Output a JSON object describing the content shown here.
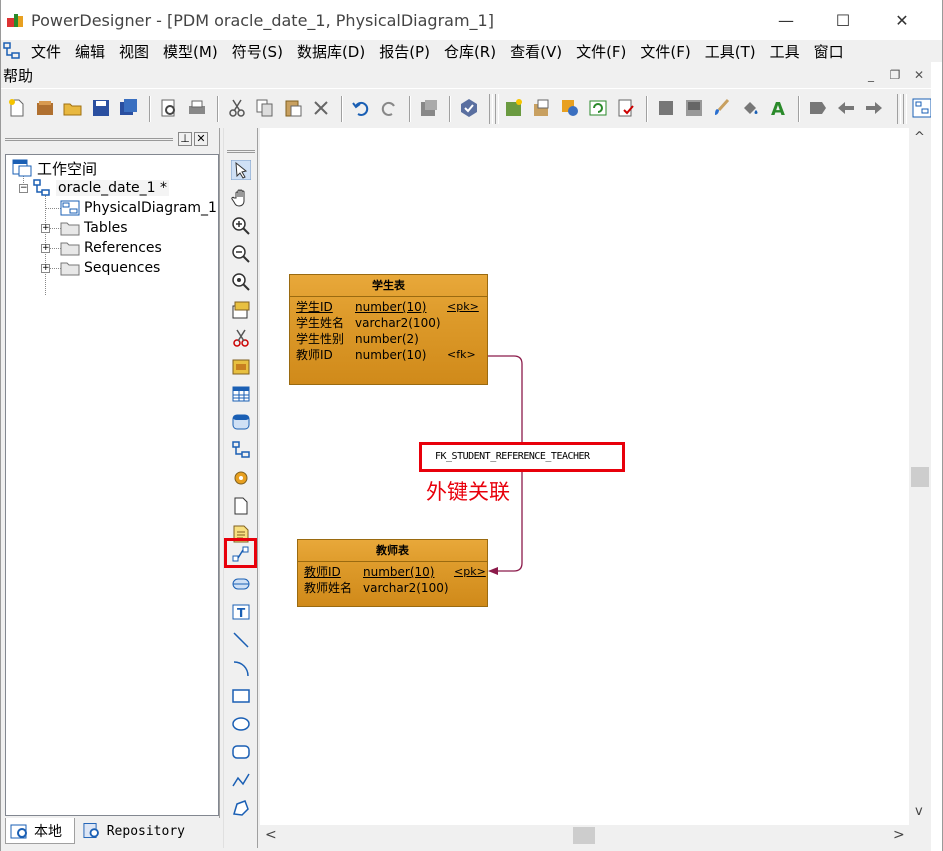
{
  "window": {
    "title": "PowerDesigner - [PDM oracle_date_1, PhysicalDiagram_1]",
    "minimize": "—",
    "maximize": "☐",
    "close": "✕"
  },
  "menu": {
    "items": [
      "文件",
      "编辑",
      "视图",
      "模型(M)",
      "符号(S)",
      "数据库(D)",
      "报告(P)",
      "仓库(R)",
      "查看(V)",
      "文件(F)",
      "文件(F)",
      "工具(T)",
      "工具",
      "窗口"
    ],
    "row2": "帮助",
    "mdi_minimize": "_",
    "mdi_restore": "❐",
    "mdi_close": "✕"
  },
  "browser": {
    "pin_button": "⊥",
    "close_button": "✕",
    "tree": {
      "workspace": "工作空间",
      "model": "oracle_date_1 *",
      "diagram": "PhysicalDiagram_1",
      "tables": "Tables",
      "references": "References",
      "sequences": "Sequences"
    },
    "tabs": {
      "local": "本地",
      "repository": "Repository"
    }
  },
  "diagram": {
    "student_table": {
      "name": "学生表",
      "columns": [
        {
          "name": "学生ID",
          "type": "number(10)",
          "key": "<pk>"
        },
        {
          "name": "学生姓名",
          "type": "varchar2(100)",
          "key": ""
        },
        {
          "name": "学生性别",
          "type": "number(2)",
          "key": ""
        },
        {
          "name": "教师ID",
          "type": "number(10)",
          "key": "<fk>"
        }
      ]
    },
    "teacher_table": {
      "name": "教师表",
      "columns": [
        {
          "name": "教师ID",
          "type": "number(10)",
          "key": "<pk>"
        },
        {
          "name": "教师姓名",
          "type": "varchar2(100)",
          "key": ""
        }
      ]
    },
    "reference_name": "FK_STUDENT_REFERENCE_TEACHER",
    "annotation": "外键关联"
  },
  "scroll": {
    "up": "^",
    "down": "v",
    "left": "<",
    "right": ">"
  },
  "colors": {
    "table_fill": "#dd9a2a",
    "highlight": "#e8000b",
    "reference_line": "#8b1a4a"
  }
}
